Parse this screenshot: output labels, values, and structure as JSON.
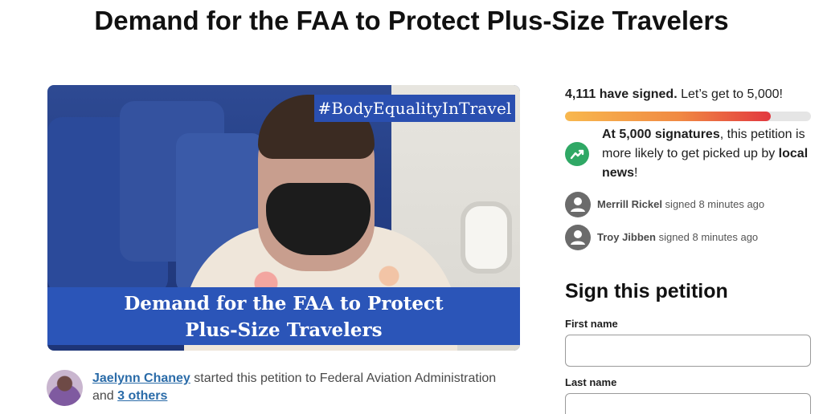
{
  "page": {
    "title": "Demand for the FAA to Protect Plus-Size Travelers"
  },
  "hero": {
    "hashtag": "#BodyEqualityInTravel",
    "banner_line1": "Demand for the FAA to Protect",
    "banner_line2": "Plus-Size Travelers"
  },
  "starter": {
    "name": "Jaelynn Chaney",
    "text_mid": " started this petition to Federal Aviation Administration and ",
    "others_link": "3 others"
  },
  "signatures": {
    "count_text": "4,111 have signed.",
    "goal_text": " Let’s get to 5,000!",
    "progress_fraction": 0.838
  },
  "milestone": {
    "bold1": "At 5,000 signatures",
    "text1": ", this petition is more likely to get picked up by ",
    "bold2": "local news",
    "text2": "!"
  },
  "recent_signers": [
    {
      "name": "Merrill Rickel",
      "time": " signed 8 minutes ago"
    },
    {
      "name": "Troy Jibben",
      "time": " signed 8 minutes ago"
    }
  ],
  "form": {
    "heading": "Sign this petition",
    "first_name_label": "First name",
    "first_name_value": "",
    "last_name_label": "Last name",
    "last_name_value": ""
  },
  "colors": {
    "accent_link": "#2a6ba8",
    "progress_start": "#f8b84e",
    "progress_end": "#e2383f",
    "trend_icon_bg": "#2fa865"
  },
  "icons": [
    "trend-up-icon",
    "user-avatar-icon"
  ]
}
